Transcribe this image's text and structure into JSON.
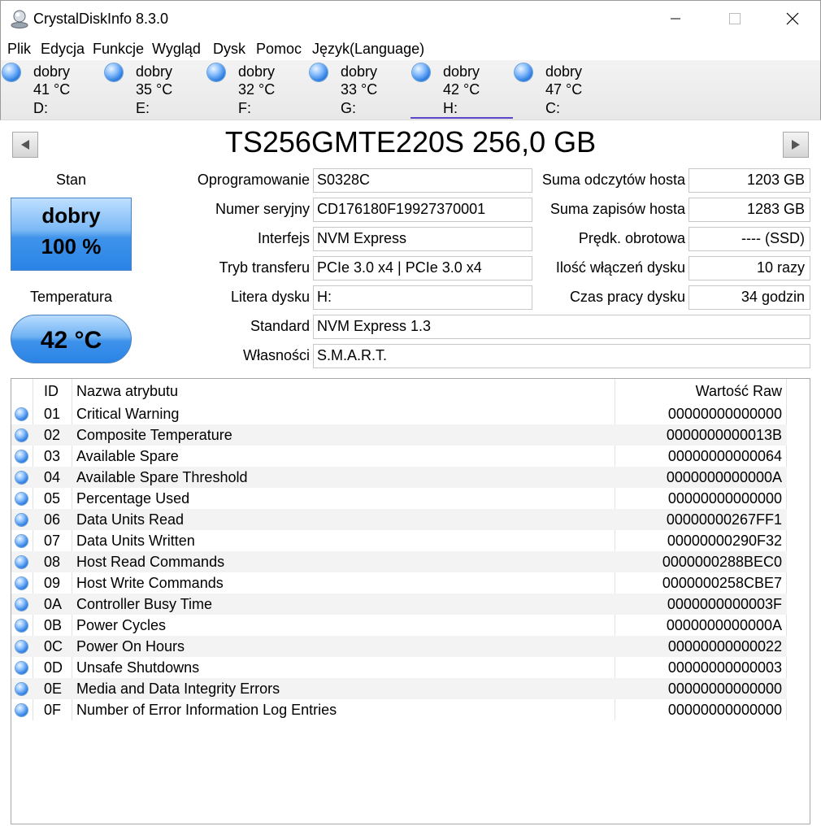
{
  "window": {
    "title": "CrystalDiskInfo 8.3.0",
    "minimize": "—",
    "maximize": "☐",
    "close": "✕"
  },
  "menu": [
    "Plik",
    "Edycja",
    "Funkcje",
    "Wygląd",
    "Dysk",
    "Pomoc",
    "Język(Language)"
  ],
  "disks": [
    {
      "status": "dobry",
      "temp": "41 °C",
      "letter": "D:"
    },
    {
      "status": "dobry",
      "temp": "35 °C",
      "letter": "E:"
    },
    {
      "status": "dobry",
      "temp": "32 °C",
      "letter": "F:"
    },
    {
      "status": "dobry",
      "temp": "33 °C",
      "letter": "G:"
    },
    {
      "status": "dobry",
      "temp": "42 °C",
      "letter": "H:",
      "active": true
    },
    {
      "status": "dobry",
      "temp": "47 °C",
      "letter": "C:"
    }
  ],
  "model": {
    "title": "TS256GMTE220S 256,0 GB"
  },
  "health": {
    "label": "Stan",
    "status": "dobry",
    "percent": "100 %",
    "temp_label": "Temperatura",
    "temp": "42 °C"
  },
  "info": {
    "firmware": {
      "label": "Oprogramowanie",
      "value": "S0328C"
    },
    "serial": {
      "label": "Numer seryjny",
      "value": "CD176180F19927370001"
    },
    "interface": {
      "label": "Interfejs",
      "value": "NVM Express"
    },
    "transfer": {
      "label": "Tryb transferu",
      "value": "PCIe 3.0 x4 | PCIe 3.0 x4"
    },
    "letter": {
      "label": "Litera dysku",
      "value": "H:"
    },
    "standard": {
      "label": "Standard",
      "value": "NVM Express 1.3"
    },
    "features": {
      "label": "Własności",
      "value": "S.M.A.R.T."
    },
    "host_reads": {
      "label": "Suma odczytów hosta",
      "value": "1203 GB"
    },
    "host_writes": {
      "label": "Suma zapisów hosta",
      "value": "1283 GB"
    },
    "rotation": {
      "label": "Prędk. obrotowa",
      "value": "---- (SSD)"
    },
    "power_count": {
      "label": "Ilość włączeń dysku",
      "value": "10 razy"
    },
    "power_hours": {
      "label": "Czas pracy dysku",
      "value": "34 godzin"
    }
  },
  "smart": {
    "headers": {
      "id": "ID",
      "name": "Nazwa atrybutu",
      "raw": "Wartość Raw"
    },
    "rows": [
      {
        "id": "01",
        "name": "Critical Warning",
        "raw": "00000000000000"
      },
      {
        "id": "02",
        "name": "Composite Temperature",
        "raw": "0000000000013B"
      },
      {
        "id": "03",
        "name": "Available Spare",
        "raw": "00000000000064"
      },
      {
        "id": "04",
        "name": "Available Spare Threshold",
        "raw": "0000000000000A"
      },
      {
        "id": "05",
        "name": "Percentage Used",
        "raw": "00000000000000"
      },
      {
        "id": "06",
        "name": "Data Units Read",
        "raw": "00000000267FF1"
      },
      {
        "id": "07",
        "name": "Data Units Written",
        "raw": "00000000290F32"
      },
      {
        "id": "08",
        "name": "Host Read Commands",
        "raw": "0000000288BEC0"
      },
      {
        "id": "09",
        "name": "Host Write Commands",
        "raw": "0000000258CBE7"
      },
      {
        "id": "0A",
        "name": "Controller Busy Time",
        "raw": "0000000000003F"
      },
      {
        "id": "0B",
        "name": "Power Cycles",
        "raw": "0000000000000A"
      },
      {
        "id": "0C",
        "name": "Power On Hours",
        "raw": "00000000000022"
      },
      {
        "id": "0D",
        "name": "Unsafe Shutdowns",
        "raw": "00000000000003"
      },
      {
        "id": "0E",
        "name": "Media and Data Integrity Errors",
        "raw": "00000000000000"
      },
      {
        "id": "0F",
        "name": "Number of Error Information Log Entries",
        "raw": "00000000000000"
      }
    ]
  }
}
